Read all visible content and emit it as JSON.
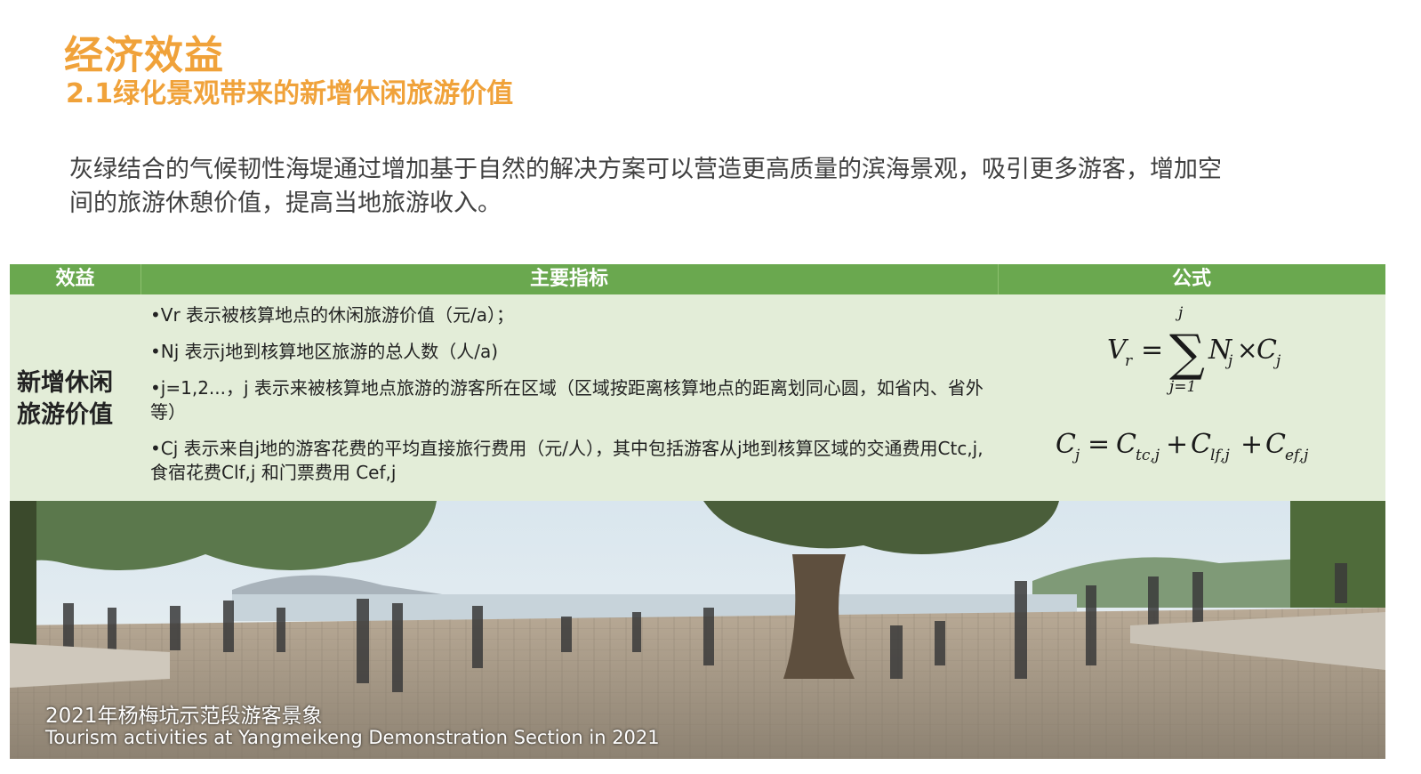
{
  "header": {
    "title": "经济效益",
    "subtitle": "2.1绿化景观带来的新增休闲旅游价值"
  },
  "intro": {
    "text": "灰绿结合的气候韧性海堤通过增加基于自然的解决方案可以营造更高质量的滨海景观，吸引更多游客，增加空间的旅游休憩价值，提高当地旅游收入。"
  },
  "table": {
    "headers": {
      "benefit": "效益",
      "index": "主要指标",
      "formula": "公式"
    },
    "benefit": {
      "line1": "新增休闲",
      "line2": "旅游价值"
    },
    "items": [
      "•Vr 表示被核算地点的休闲旅游价值（元/a）；",
      "•Nj 表示j地到核算地区旅游的总人数（人/a)",
      "•j=1,2...，j 表示来被核算地点旅游的游客所在区域（区域按距离核算地点的距离划同心圆，如省内、省外等）",
      "•Cj 表示来自j地的游客花费的平均直接旅行费用（元/人），其中包括游客从j地到核算区域的交通费用Ctc,j, 食宿花费Clf,j 和门票费用 Cef,j"
    ]
  },
  "photo": {
    "caption_cn": "2021年杨梅坑示范段游客景象",
    "caption_en": "Tourism activities at Yangmeikeng Demonstration Section in 2021"
  },
  "colors": {
    "accent": "#f0a23a",
    "header_green": "#6aa84f",
    "table_bg": "#e3edd8"
  }
}
